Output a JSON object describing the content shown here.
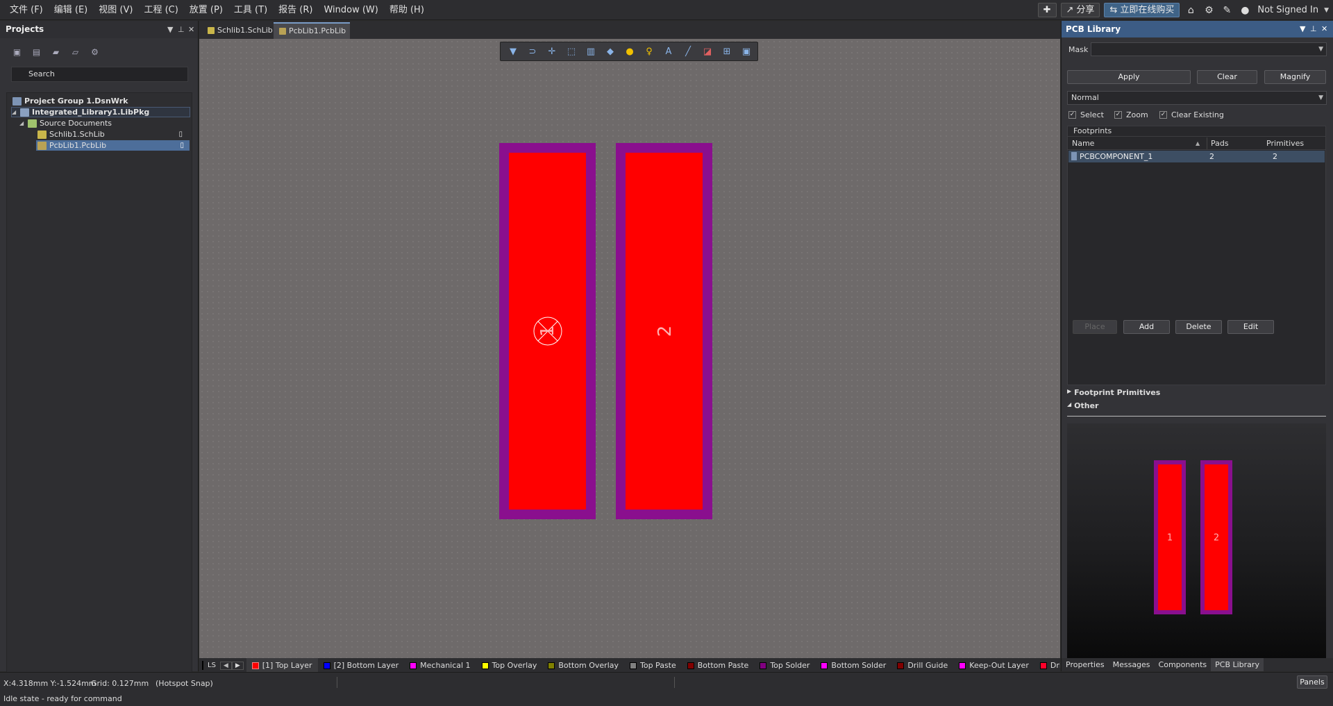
{
  "menubar": {
    "items": [
      "文件 (F)",
      "编辑 (E)",
      "视图 (V)",
      "工程 (C)",
      "放置 (P)",
      "工具 (T)",
      "报告 (R)",
      "Window (W)",
      "帮助 (H)"
    ],
    "share_label": "分享",
    "buy_label": "立即在线购买",
    "user_label": "Not Signed In"
  },
  "projects": {
    "title": "Projects",
    "search_placeholder": "Search",
    "tree": {
      "group": "Project Group 1.DsnWrk",
      "project": "Integrated_Library1.LibPkg",
      "folder": "Source Documents",
      "doc1": "Schlib1.SchLib",
      "doc2": "PcbLib1.PcbLib"
    }
  },
  "tabs": [
    "Schlib1.SchLib",
    "PcbLib1.PcbLib"
  ],
  "canvas": {
    "pad1_label": "1",
    "pad2_label": "2"
  },
  "layers": {
    "current_swatch": "LS",
    "items": [
      {
        "label": "[1] Top Layer",
        "color": "#ff0000"
      },
      {
        "label": "[2] Bottom Layer",
        "color": "#0000ff"
      },
      {
        "label": "Mechanical 1",
        "color": "#ff00ff"
      },
      {
        "label": "Top Overlay",
        "color": "#ffff00"
      },
      {
        "label": "Bottom Overlay",
        "color": "#808000"
      },
      {
        "label": "Top Paste",
        "color": "#808080"
      },
      {
        "label": "Bottom Paste",
        "color": "#800000"
      },
      {
        "label": "Top Solder",
        "color": "#800080"
      },
      {
        "label": "Bottom Solder",
        "color": "#ff00ff"
      },
      {
        "label": "Drill Guide",
        "color": "#800000"
      },
      {
        "label": "Keep-Out Layer",
        "color": "#ff00ff"
      },
      {
        "label": "Drill Drawin",
        "color": "#ff002a"
      }
    ]
  },
  "pcb_library": {
    "title": "PCB Library",
    "mask_label": "Mask",
    "apply": "Apply",
    "clear": "Clear",
    "magnify": "Magnify",
    "mode": "Normal",
    "select_label": "Select",
    "zoom_label": "Zoom",
    "clear_existing_label": "Clear Existing",
    "footprints_label": "Footprints",
    "columns": [
      "Name",
      "Pads",
      "Primitives"
    ],
    "rows": [
      {
        "name": "PCBCOMPONENT_1",
        "pads": "2",
        "primitives": "2"
      }
    ],
    "place": "Place",
    "add": "Add",
    "delete": "Delete",
    "edit": "Edit",
    "footprint_primitives": "Footprint Primitives",
    "other": "Other",
    "preview_pad1": "1",
    "preview_pad2": "2"
  },
  "bottom_tabs": [
    "Properties",
    "Messages",
    "Components",
    "PCB Library"
  ],
  "status": {
    "coords": "X:4.318mm Y:-1.524mm",
    "grid": "Grid: 0.127mm",
    "snap": "(Hotspot Snap)",
    "panels": "Panels",
    "idle": "Idle state - ready for command"
  }
}
